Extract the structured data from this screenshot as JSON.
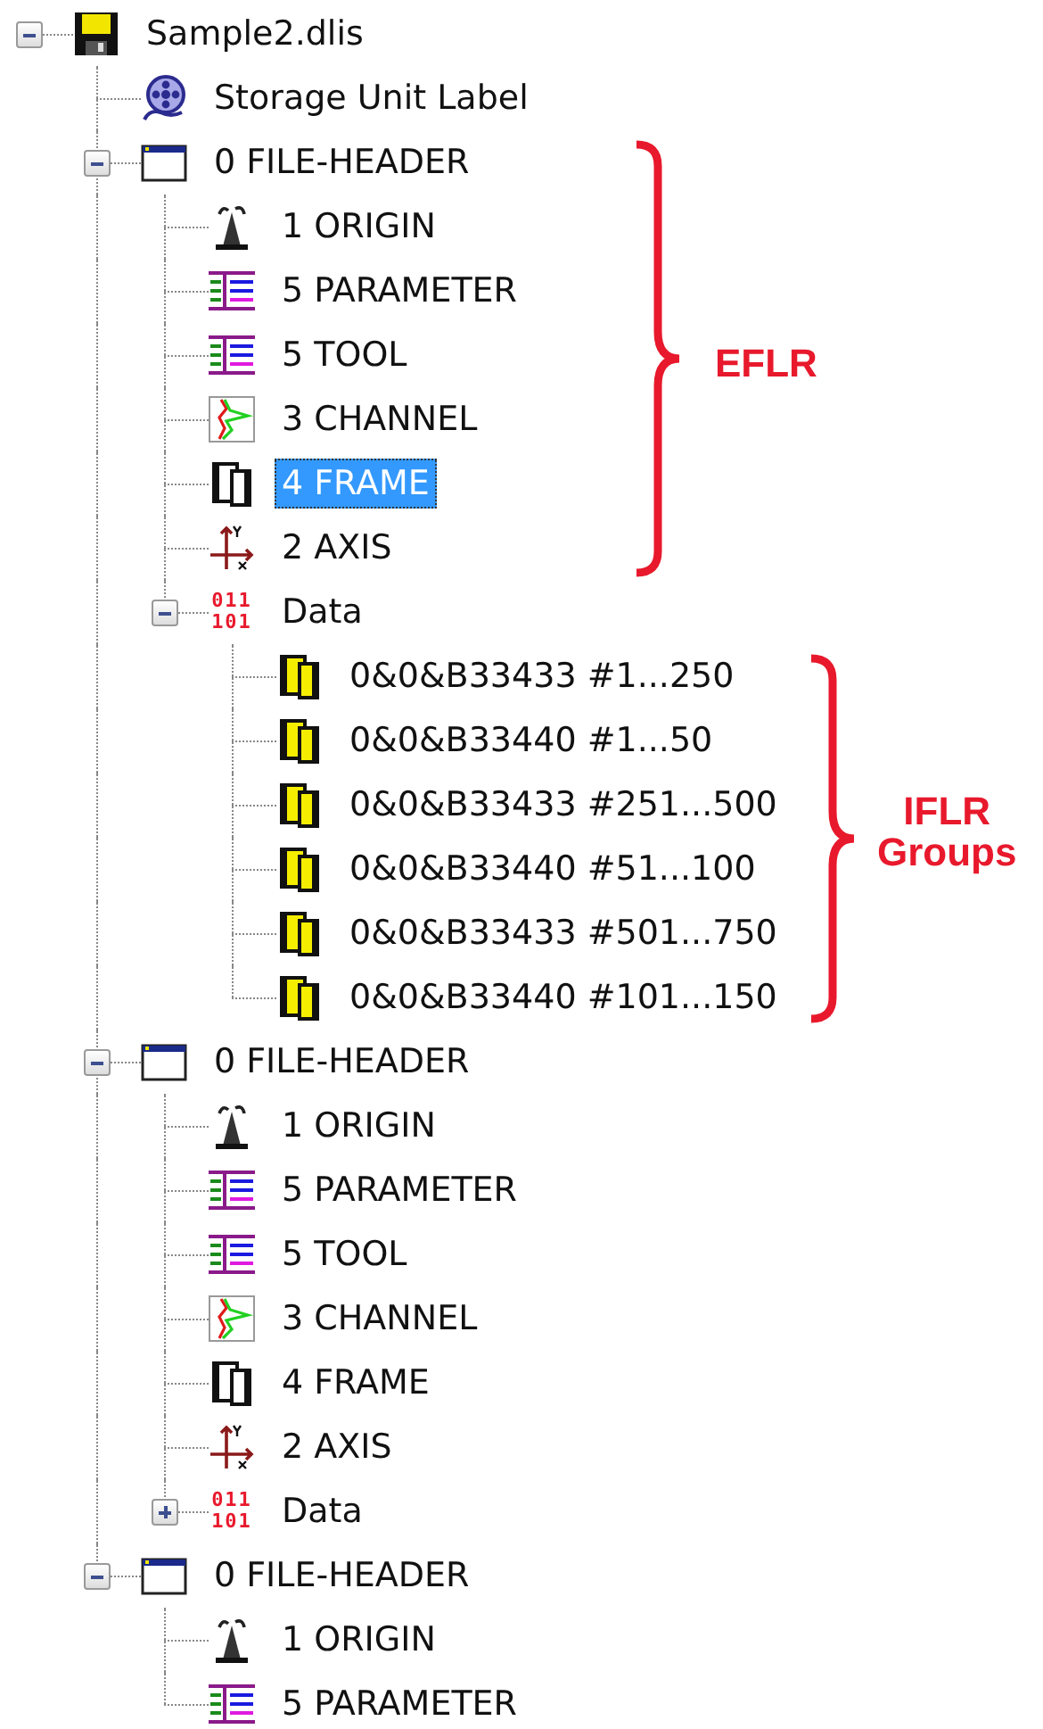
{
  "tree": [
    {
      "kind": "file",
      "label": "Sample2.dlis",
      "expanded": true,
      "selected": false,
      "children": [
        {
          "kind": "label",
          "label": "Storage Unit Label",
          "selected": false
        },
        {
          "kind": "header",
          "label": "0 FILE-HEADER",
          "expanded": true,
          "selected": false,
          "children": [
            {
              "kind": "origin",
              "label": "1 ORIGIN",
              "selected": false
            },
            {
              "kind": "table",
              "label": "5 PARAMETER",
              "selected": false
            },
            {
              "kind": "table",
              "label": "5 TOOL",
              "selected": false
            },
            {
              "kind": "channel",
              "label": "3 CHANNEL",
              "selected": false
            },
            {
              "kind": "frame",
              "label": "4 FRAME",
              "selected": true
            },
            {
              "kind": "axis",
              "label": "2 AXIS",
              "selected": false
            },
            {
              "kind": "data",
              "label": "Data",
              "icon_text": [
                "011",
                "101"
              ],
              "expanded": true,
              "selected": false,
              "children": [
                {
                  "kind": "iflr",
                  "label": "0&0&B33433 #1...250",
                  "selected": false
                },
                {
                  "kind": "iflr",
                  "label": "0&0&B33440 #1...50",
                  "selected": false
                },
                {
                  "kind": "iflr",
                  "label": "0&0&B33433 #251...500",
                  "selected": false
                },
                {
                  "kind": "iflr",
                  "label": "0&0&B33440 #51...100",
                  "selected": false
                },
                {
                  "kind": "iflr",
                  "label": "0&0&B33433 #501...750",
                  "selected": false
                },
                {
                  "kind": "iflr",
                  "label": "0&0&B33440 #101...150",
                  "selected": false
                }
              ]
            }
          ]
        },
        {
          "kind": "header",
          "label": "0 FILE-HEADER",
          "expanded": true,
          "selected": false,
          "children": [
            {
              "kind": "origin",
              "label": "1 ORIGIN",
              "selected": false
            },
            {
              "kind": "table",
              "label": "5 PARAMETER",
              "selected": false
            },
            {
              "kind": "table",
              "label": "5 TOOL",
              "selected": false
            },
            {
              "kind": "channel",
              "label": "3 CHANNEL",
              "selected": false
            },
            {
              "kind": "frame",
              "label": "4 FRAME",
              "selected": false
            },
            {
              "kind": "axis",
              "label": "2 AXIS",
              "selected": false
            },
            {
              "kind": "data",
              "label": "Data",
              "icon_text": [
                "011",
                "101"
              ],
              "expanded": false,
              "selected": false
            }
          ]
        },
        {
          "kind": "header",
          "label": "0 FILE-HEADER",
          "expanded": true,
          "selected": false,
          "children": [
            {
              "kind": "origin",
              "label": "1 ORIGIN",
              "selected": false
            },
            {
              "kind": "table",
              "label": "5 PARAMETER",
              "selected": false
            }
          ]
        }
      ]
    }
  ],
  "annotations": [
    {
      "lines": [
        "EFLR"
      ]
    },
    {
      "lines": [
        "IFLR",
        "Groups"
      ]
    }
  ]
}
